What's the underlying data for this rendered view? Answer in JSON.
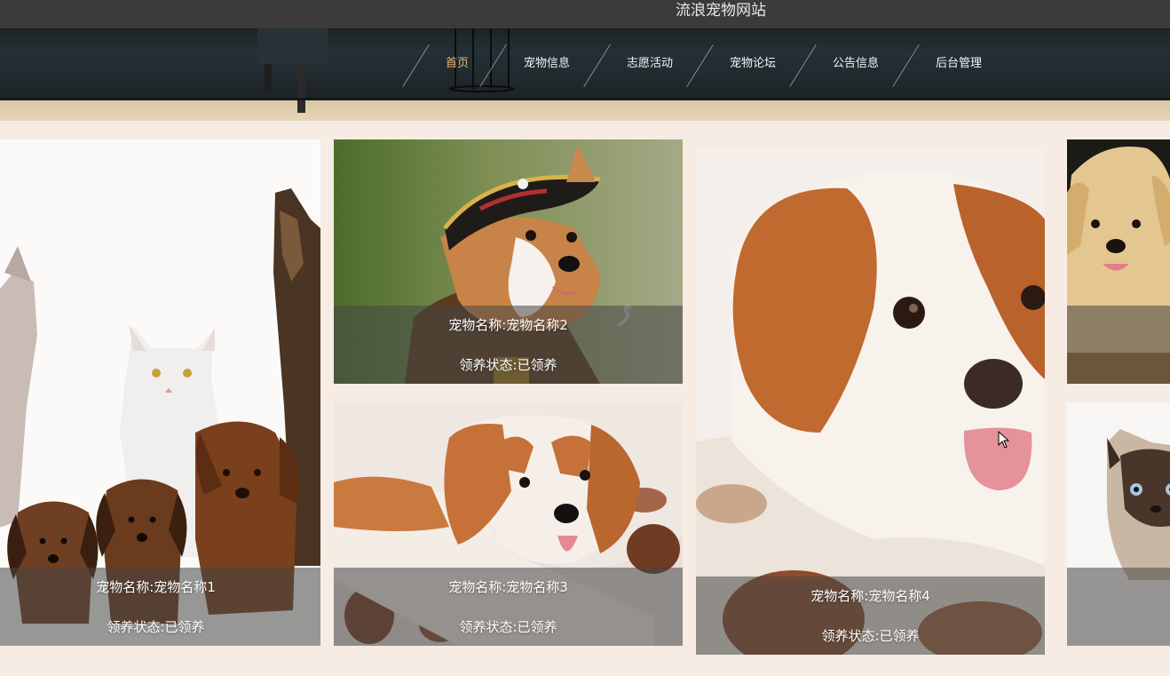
{
  "header": {
    "site_title": "流浪宠物网站"
  },
  "nav": {
    "items": [
      {
        "label": "首页",
        "active": true
      },
      {
        "label": "宠物信息",
        "active": false
      },
      {
        "label": "志愿活动",
        "active": false
      },
      {
        "label": "宠物论坛",
        "active": false
      },
      {
        "label": "公告信息",
        "active": false
      },
      {
        "label": "后台管理",
        "active": false
      }
    ]
  },
  "pets": [
    {
      "name_label": "宠物名称:宠物名称1",
      "status_label": "领养状态:已领养"
    },
    {
      "name_label": "宠物名称:宠物名称2",
      "status_label": "领养状态:已领养"
    },
    {
      "name_label": "宠物名称:宠物名称3",
      "status_label": "领养状态:已领养"
    },
    {
      "name_label": "宠物名称:宠物名称4",
      "status_label": "领养状态:已领养"
    },
    {
      "name_label": "",
      "status_label": ""
    },
    {
      "name_label": "",
      "status_label": ""
    }
  ],
  "colors": {
    "nav_active": "#e3b873",
    "nav_text": "#f4f4f4",
    "page_background": "#f6ece3",
    "overlay": "rgba(70,70,70,0.55)"
  }
}
